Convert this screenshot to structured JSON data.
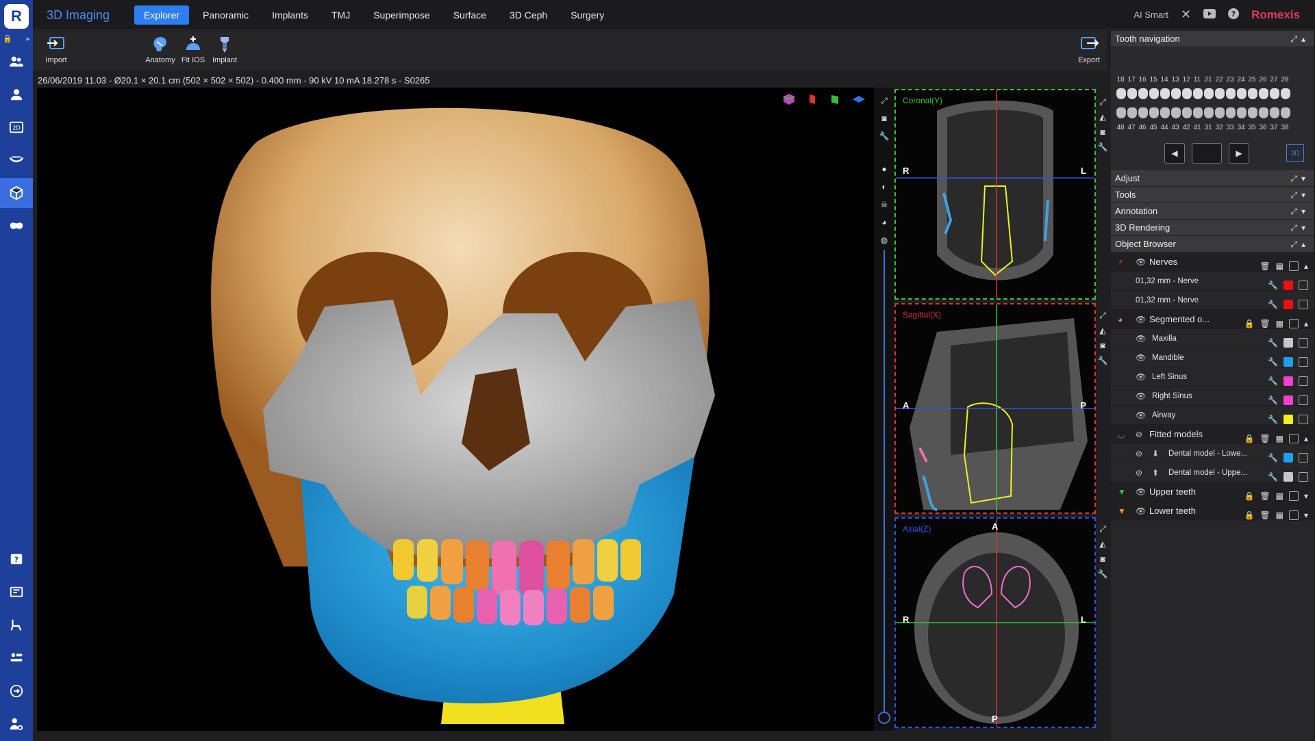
{
  "app": {
    "title": "3D Imaging",
    "brand": "Romexis",
    "ai_label": "AI Smart"
  },
  "tabs": [
    {
      "label": "Explorer",
      "active": true
    },
    {
      "label": "Panoramic"
    },
    {
      "label": "Implants"
    },
    {
      "label": "TMJ"
    },
    {
      "label": "Superimpose"
    },
    {
      "label": "Surface"
    },
    {
      "label": "3D Ceph"
    },
    {
      "label": "Surgery"
    }
  ],
  "toolbar": {
    "import_label": "Import",
    "anatomy_label": "Anatomy",
    "fitios_label": "Fit IOS",
    "implant_label": "Implant",
    "export_label": "Export"
  },
  "scan_info": "26/06/2019 11.03 - Ø20.1 × 20.1 cm (502 × 502 × 502) - 0.400 mm - 90 kV 10 mA 18.278 s - S0265",
  "slices": {
    "coronal": {
      "label": "Coronal(Y)",
      "left": "R",
      "right": "L",
      "color": "#32c832"
    },
    "sagittal": {
      "label": "Sagittal(X)",
      "left": "A",
      "right": "P",
      "color": "#e23030"
    },
    "axial": {
      "label": "Axial(Z)",
      "top": "A",
      "bottom": "P",
      "left": "R",
      "right": "L",
      "color": "#3050e8"
    }
  },
  "panel": {
    "tooth_nav_title": "Tooth navigation",
    "upper_numbers": [
      "18",
      "17",
      "16",
      "15",
      "14",
      "13",
      "12",
      "11",
      "21",
      "22",
      "23",
      "24",
      "25",
      "26",
      "27",
      "28"
    ],
    "lower_numbers": [
      "48",
      "47",
      "46",
      "45",
      "44",
      "43",
      "42",
      "41",
      "31",
      "32",
      "33",
      "34",
      "35",
      "36",
      "37",
      "38"
    ],
    "view_3d": "3D",
    "sections": [
      "Adjust",
      "Tools",
      "Annotation",
      "3D Rendering",
      "Object Browser"
    ],
    "object_browser": {
      "nerves": {
        "label": "Nerves",
        "children": [
          {
            "label": "01,32 mm - Nerve",
            "color": "#e81010"
          },
          {
            "label": "01,32 mm - Nerve",
            "color": "#e81010"
          }
        ]
      },
      "segmented": {
        "label": "Segmented o...",
        "children": [
          {
            "label": "Maxilla",
            "color": "#c8c8c8"
          },
          {
            "label": "Mandible",
            "color": "#1ea0f0"
          },
          {
            "label": "Left Sinus",
            "color": "#f040d0"
          },
          {
            "label": "Right Sinus",
            "color": "#f040d0"
          },
          {
            "label": "Airway",
            "color": "#f0f020"
          }
        ]
      },
      "fitted": {
        "label": "Fitted models",
        "children": [
          {
            "label": "Dental model - Lowe...",
            "color": "#1ea0f0"
          },
          {
            "label": "Dental model - Uppe...",
            "color": "#c8c8c8"
          }
        ]
      },
      "upper_teeth": {
        "label": "Upper teeth"
      },
      "lower_teeth": {
        "label": "Lower teeth"
      }
    }
  }
}
